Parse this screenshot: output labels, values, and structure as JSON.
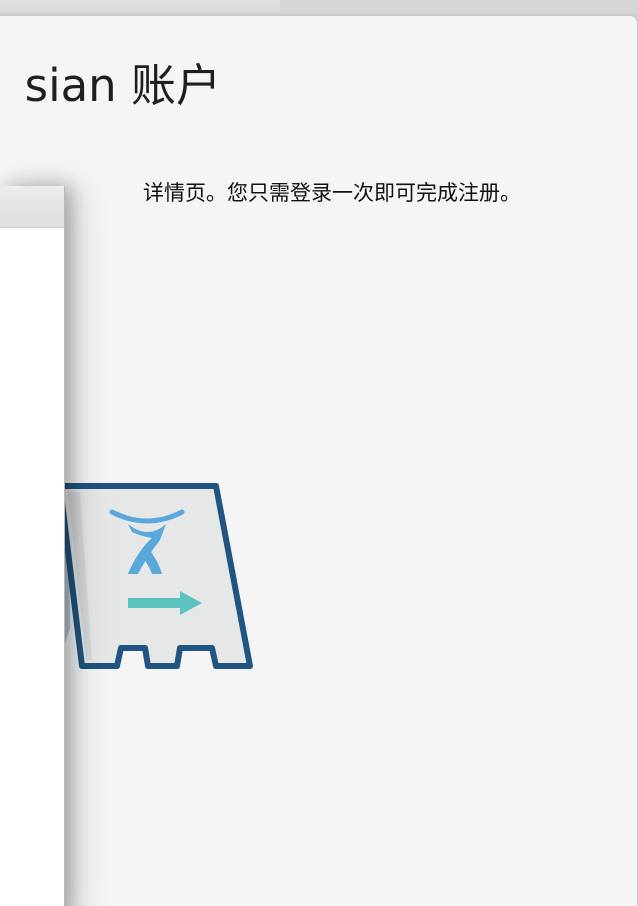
{
  "dialog": {
    "title": "sian 账户",
    "description": "详情页。您只需登录一次即可完成注册。"
  },
  "illustration": {
    "icon": "atlassian-sign-board-icon",
    "arrow_icon": "arrow-right-icon",
    "colors": {
      "frame": "#1f5580",
      "board": "#e6e8e8",
      "logo": "#5aa7dc",
      "arrow": "#5bc2c0",
      "shadow": "#b8c4d0"
    }
  }
}
